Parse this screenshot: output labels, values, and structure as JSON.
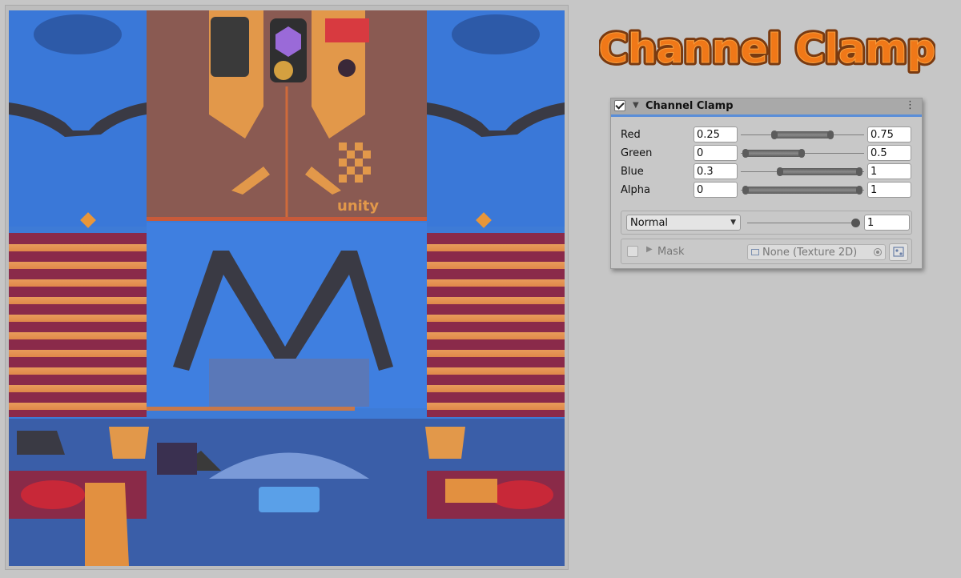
{
  "title": "Channel Clamp",
  "panel": {
    "header_title": "Channel Clamp",
    "enabled": true,
    "channels": [
      {
        "label": "Red",
        "min": "0.25",
        "max": "0.75",
        "min_value": 0.25,
        "max_value": 0.75
      },
      {
        "label": "Green",
        "min": "0",
        "max": "0.5",
        "min_value": 0,
        "max_value": 0.5
      },
      {
        "label": "Blue",
        "min": "0.3",
        "max": "1",
        "min_value": 0.3,
        "max_value": 1
      },
      {
        "label": "Alpha",
        "min": "0",
        "max": "1",
        "min_value": 0,
        "max_value": 1
      }
    ],
    "blend": {
      "mode": "Normal",
      "opacity": "1",
      "opacity_value": 1
    },
    "mask": {
      "label": "Mask",
      "texture": "None (Texture 2D)",
      "enabled": false
    }
  },
  "preview": {
    "texture_text": "unity"
  },
  "colors": {
    "accent": "#5a8ed8",
    "title_orange": "#f07818"
  }
}
